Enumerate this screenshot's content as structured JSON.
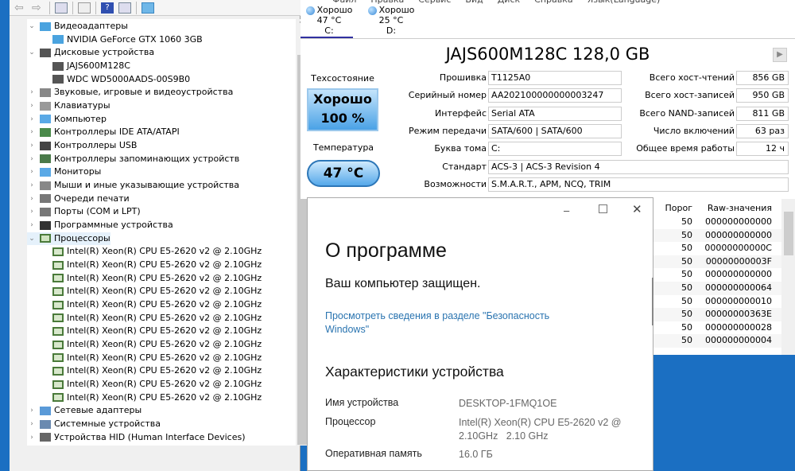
{
  "device_manager": {
    "categories": [
      {
        "label": "Видеоадаптеры",
        "expanded": true,
        "children": [
          "NVIDIA GeForce GTX 1060 3GB"
        ]
      },
      {
        "label": "Дисковые устройства",
        "expanded": true,
        "children": [
          "JAJS600M128C",
          "WDC WD5000AADS-00S9B0"
        ]
      },
      {
        "label": "Звуковые, игровые и видеоустройства"
      },
      {
        "label": "Клавиатуры"
      },
      {
        "label": "Компьютер"
      },
      {
        "label": "Контроллеры IDE ATA/ATAPI"
      },
      {
        "label": "Контроллеры USB"
      },
      {
        "label": "Контроллеры запоминающих устройств"
      },
      {
        "label": "Мониторы"
      },
      {
        "label": "Мыши и иные указывающие устройства"
      },
      {
        "label": "Очереди печати"
      },
      {
        "label": "Порты (COM и LPT)"
      },
      {
        "label": "Программные устройства"
      },
      {
        "label": "Процессоры",
        "expanded": true,
        "selected": true,
        "children": [
          "Intel(R) Xeon(R) CPU E5-2620 v2 @ 2.10GHz",
          "Intel(R) Xeon(R) CPU E5-2620 v2 @ 2.10GHz",
          "Intel(R) Xeon(R) CPU E5-2620 v2 @ 2.10GHz",
          "Intel(R) Xeon(R) CPU E5-2620 v2 @ 2.10GHz",
          "Intel(R) Xeon(R) CPU E5-2620 v2 @ 2.10GHz",
          "Intel(R) Xeon(R) CPU E5-2620 v2 @ 2.10GHz",
          "Intel(R) Xeon(R) CPU E5-2620 v2 @ 2.10GHz",
          "Intel(R) Xeon(R) CPU E5-2620 v2 @ 2.10GHz",
          "Intel(R) Xeon(R) CPU E5-2620 v2 @ 2.10GHz",
          "Intel(R) Xeon(R) CPU E5-2620 v2 @ 2.10GHz",
          "Intel(R) Xeon(R) CPU E5-2620 v2 @ 2.10GHz",
          "Intel(R) Xeon(R) CPU E5-2620 v2 @ 2.10GHz"
        ]
      },
      {
        "label": "Сетевые адаптеры"
      },
      {
        "label": "Системные устройства"
      },
      {
        "label": "Устройства HID (Human Interface Devices)"
      }
    ]
  },
  "crystaldisk": {
    "menu": [
      "Файл",
      "Правка",
      "Сервис",
      "Вид",
      "Диск",
      "Справка",
      "Язык(Language)"
    ],
    "drives": [
      {
        "status": "Хорошо",
        "temp": "47 °C",
        "letter": "C:"
      },
      {
        "status": "Хорошо",
        "temp": "25 °C",
        "letter": "D:"
      }
    ],
    "title": "JAJS600M128C 128,0 GB",
    "health_label": "Техсостояние",
    "health_status": "Хорошо",
    "health_percent": "100 %",
    "temp_label": "Температура",
    "temp_value": "47 °C",
    "fields": [
      {
        "label": "Прошивка",
        "value": "T1125A0"
      },
      {
        "label": "Серийный номер",
        "value": "AA202100000000003247"
      },
      {
        "label": "Интерфейс",
        "value": "Serial ATA"
      },
      {
        "label": "Режим передачи",
        "value": "SATA/600 | SATA/600"
      },
      {
        "label": "Буква тома",
        "value": "C:"
      },
      {
        "label": "Стандарт",
        "value": "ACS-3 | ACS-3 Revision 4"
      },
      {
        "label": "Возможности",
        "value": "S.M.A.R.T., APM, NCQ, TRIM"
      }
    ],
    "stats": [
      {
        "label": "Всего хост-чтений",
        "value": "856 GB"
      },
      {
        "label": "Всего хост-записей",
        "value": "950 GB"
      },
      {
        "label": "Всего NAND-записей",
        "value": "811 GB"
      },
      {
        "label": "Число включений",
        "value": "63 раз"
      },
      {
        "label": "Общее время работы",
        "value": "12 ч"
      }
    ],
    "smart": {
      "headers": [
        "Порог",
        "Raw-значения"
      ],
      "rows": [
        [
          "50",
          "000000000000"
        ],
        [
          "50",
          "000000000000"
        ],
        [
          "50",
          "00000000000C"
        ],
        [
          "50",
          "00000000003F"
        ],
        [
          "50",
          "000000000000"
        ],
        [
          "50",
          "000000000064"
        ],
        [
          "50",
          "000000000010"
        ],
        [
          "50",
          "00000000363E"
        ],
        [
          "50",
          "000000000028"
        ],
        [
          "50",
          "000000000004"
        ]
      ]
    }
  },
  "about": {
    "title": "О программе",
    "protected": "Ваш компьютер защищен.",
    "link": "Просмотреть сведения в разделе \"Безопасность Windows\"",
    "specs_title": "Характеристики устройства",
    "specs": [
      {
        "label": "Имя устройства",
        "value": "DESKTOP-1FMQ1OE"
      },
      {
        "label": "Процессор",
        "value": "Intel(R) Xeon(R) CPU E5-2620 v2 @ 2.10GHz   2.10 GHz"
      },
      {
        "label": "Оперативная память",
        "value": "16.0 ГБ"
      }
    ]
  }
}
